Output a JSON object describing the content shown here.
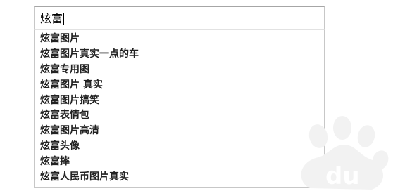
{
  "search": {
    "value": "炫富"
  },
  "suggestions": [
    "炫富图片",
    "炫富图片真实一点的车",
    "炫富专用图",
    "炫富图片 真实",
    "炫富图片搞笑",
    "炫富表情包",
    "炫富图片高清",
    "炫富头像",
    "炫富摔",
    "炫富人民币图片真实"
  ],
  "watermark": {
    "text": "du",
    "icon": "baidu-paw-icon",
    "color": "#f1f1f1"
  }
}
